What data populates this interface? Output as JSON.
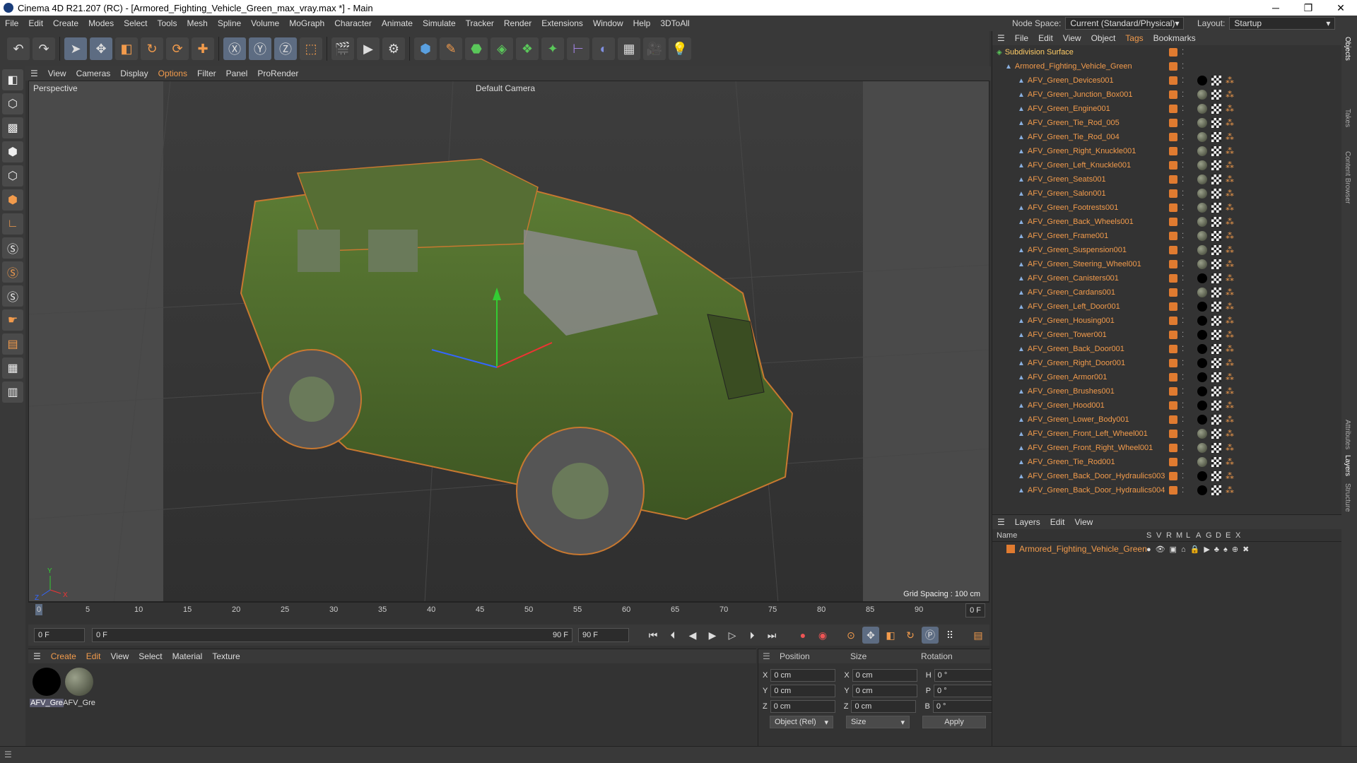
{
  "window": {
    "title": "Cinema 4D R21.207 (RC) - [Armored_Fighting_Vehicle_Green_max_vray.max *] - Main"
  },
  "menu": {
    "items": [
      "File",
      "Edit",
      "Create",
      "Modes",
      "Select",
      "Tools",
      "Mesh",
      "Spline",
      "Volume",
      "MoGraph",
      "Character",
      "Animate",
      "Simulate",
      "Tracker",
      "Render",
      "Extensions",
      "Window",
      "Help",
      "3DToAll"
    ]
  },
  "node_space": {
    "label": "Node Space:",
    "value": "Current (Standard/Physical)"
  },
  "layout": {
    "label": "Layout:",
    "value": "Startup"
  },
  "viewport": {
    "menu": [
      "View",
      "Cameras",
      "Display",
      "Options",
      "Filter",
      "Panel",
      "ProRender"
    ],
    "label": "Perspective",
    "camera": "Default Camera",
    "grid_spacing": "Grid Spacing : 100 cm",
    "axis_labels": {
      "y": "Y",
      "z": "Z",
      "x": "X"
    }
  },
  "timeline": {
    "ticks": [
      "0",
      "5",
      "10",
      "15",
      "20",
      "25",
      "30",
      "35",
      "40",
      "45",
      "50",
      "55",
      "60",
      "65",
      "70",
      "75",
      "80",
      "85",
      "90"
    ],
    "end_field": "0 F"
  },
  "playback": {
    "start": "0 F",
    "current": "0 F",
    "end_small": "90 F",
    "end": "90 F"
  },
  "material_manager": {
    "menu": [
      "Create",
      "Edit",
      "View",
      "Select",
      "Material",
      "Texture"
    ],
    "materials": [
      {
        "label": "AFV_Gre",
        "color": "#000000"
      },
      {
        "label": "AFV_Gre",
        "color": "#6f7563"
      }
    ]
  },
  "coordinates": {
    "headers": {
      "position": "Position",
      "size": "Size",
      "rotation": "Rotation"
    },
    "rows": [
      {
        "axis": "X",
        "pos": "0 cm",
        "size_axis": "X",
        "size": "0 cm",
        "rot_axis": "H",
        "rot": "0 °"
      },
      {
        "axis": "Y",
        "pos": "0 cm",
        "size_axis": "Y",
        "size": "0 cm",
        "rot_axis": "P",
        "rot": "0 °"
      },
      {
        "axis": "Z",
        "pos": "0 cm",
        "size_axis": "Z",
        "size": "0 cm",
        "rot_axis": "B",
        "rot": "0 °"
      }
    ],
    "mode": "Object (Rel)",
    "size_mode": "Size",
    "apply": "Apply"
  },
  "object_manager": {
    "menu": [
      "File",
      "Edit",
      "View",
      "Object",
      "Tags",
      "Bookmarks"
    ],
    "root": "Subdivision Surface",
    "group": "Armored_Fighting_Vehicle_Green",
    "objects": [
      {
        "name": "AFV_Green_Devices001",
        "mat": "#000000"
      },
      {
        "name": "AFV_Green_Junction_Box001",
        "mat": "#6f7563"
      },
      {
        "name": "AFV_Green_Engine001",
        "mat": "#6f7563"
      },
      {
        "name": "AFV_Green_Tie_Rod_005",
        "mat": "#6f7563"
      },
      {
        "name": "AFV_Green_Tie_Rod_004",
        "mat": "#6f7563"
      },
      {
        "name": "AFV_Green_Right_Knuckle001",
        "mat": "#6f7563"
      },
      {
        "name": "AFV_Green_Left_Knuckle001",
        "mat": "#6f7563"
      },
      {
        "name": "AFV_Green_Seats001",
        "mat": "#6f7563"
      },
      {
        "name": "AFV_Green_Salon001",
        "mat": "#6f7563"
      },
      {
        "name": "AFV_Green_Footrests001",
        "mat": "#6f7563"
      },
      {
        "name": "AFV_Green_Back_Wheels001",
        "mat": "#6f7563"
      },
      {
        "name": "AFV_Green_Frame001",
        "mat": "#6f7563"
      },
      {
        "name": "AFV_Green_Suspension001",
        "mat": "#6f7563"
      },
      {
        "name": "AFV_Green_Steering_Wheel001",
        "mat": "#6f7563"
      },
      {
        "name": "AFV_Green_Canisters001",
        "mat": "#000000"
      },
      {
        "name": "AFV_Green_Cardans001",
        "mat": "#6f7563"
      },
      {
        "name": "AFV_Green_Left_Door001",
        "mat": "#000000"
      },
      {
        "name": "AFV_Green_Housing001",
        "mat": "#000000"
      },
      {
        "name": "AFV_Green_Tower001",
        "mat": "#000000"
      },
      {
        "name": "AFV_Green_Back_Door001",
        "mat": "#000000"
      },
      {
        "name": "AFV_Green_Right_Door001",
        "mat": "#000000"
      },
      {
        "name": "AFV_Green_Armor001",
        "mat": "#000000"
      },
      {
        "name": "AFV_Green_Brushes001",
        "mat": "#000000"
      },
      {
        "name": "AFV_Green_Hood001",
        "mat": "#000000"
      },
      {
        "name": "AFV_Green_Lower_Body001",
        "mat": "#000000"
      },
      {
        "name": "AFV_Green_Front_Left_Wheel001",
        "mat": "#6f7563"
      },
      {
        "name": "AFV_Green_Front_Right_Wheel001",
        "mat": "#6f7563"
      },
      {
        "name": "AFV_Green_Tie_Rod001",
        "mat": "#6f7563"
      },
      {
        "name": "AFV_Green_Back_Door_Hydraulics003",
        "mat": "#000000"
      },
      {
        "name": "AFV_Green_Back_Door_Hydraulics004",
        "mat": "#000000"
      }
    ]
  },
  "layers": {
    "menu": [
      "Layers",
      "Edit",
      "View"
    ],
    "columns": [
      "Name",
      "S",
      "V",
      "R",
      "M",
      "L",
      "A",
      "G",
      "D",
      "E",
      "X"
    ],
    "rows": [
      {
        "name": "Armored_Fighting_Vehicle_Green",
        "color": "#e07b30"
      }
    ]
  },
  "right_tabs": [
    "Objects",
    "Takes",
    "Content Browser",
    "Attributes",
    "Layers",
    "Structure"
  ],
  "colors": {
    "accent": "#f29b4c",
    "selected": "#5d6c82",
    "vehicle_green": "#4a6a2a"
  }
}
